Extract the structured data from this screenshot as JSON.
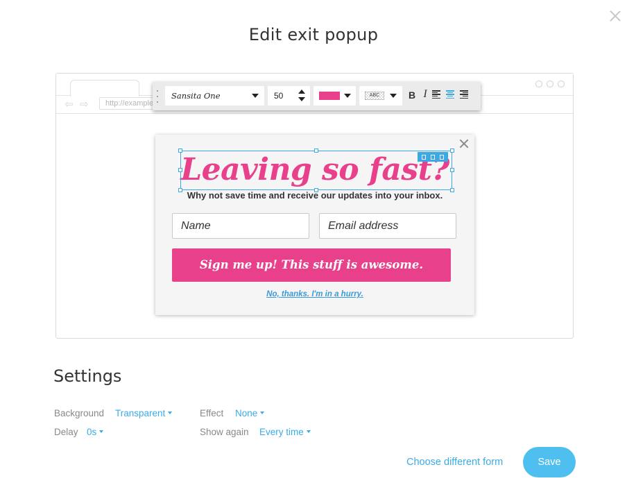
{
  "modal": {
    "title": "Edit exit popup"
  },
  "browser": {
    "url": "http://example.com"
  },
  "toolbar": {
    "font": "Sansita One",
    "font_size": "50",
    "text_color": "#e8408a",
    "background_label": "ABC",
    "bold_label": "B",
    "italic_label": "I",
    "alignment": "center"
  },
  "popup": {
    "headline": "Leaving so fast?",
    "subline": "Why not save time and receive our updates into your inbox.",
    "name_placeholder": "Name",
    "email_placeholder": "Email address",
    "button_label": "Sign me up! This stuff is awesome.",
    "decline_label": "No, thanks. I'm in a hurry.",
    "accent_color": "#e8408a"
  },
  "settings": {
    "title": "Settings",
    "background_label": "Background",
    "background_value": "Transparent",
    "effect_label": "Effect",
    "effect_value": "None",
    "delay_label": "Delay",
    "delay_value": "0s",
    "show_again_label": "Show again",
    "show_again_value": "Every time"
  },
  "footer": {
    "choose_label": "Choose different form",
    "save_label": "Save"
  }
}
